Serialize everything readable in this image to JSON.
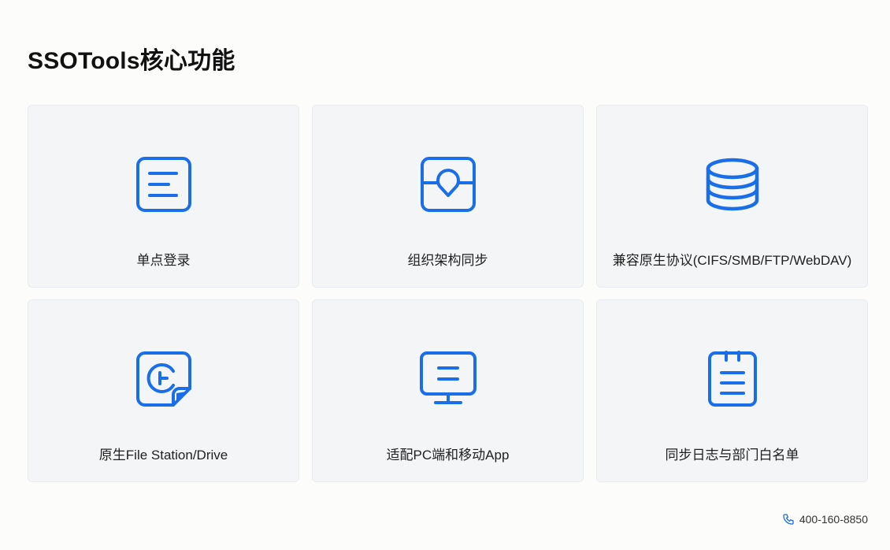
{
  "page": {
    "title": "SSOTools核心功能"
  },
  "features": [
    {
      "label": "单点登录",
      "icon": "document-lines-icon"
    },
    {
      "label": "组织架构同步",
      "icon": "location-pin-icon"
    },
    {
      "label": "兼容原生协议(CIFS/SMB/FTP/WebDAV)",
      "icon": "database-icon"
    },
    {
      "label": "原生File Station/Drive",
      "icon": "file-station-icon"
    },
    {
      "label": "适配PC端和移动App",
      "icon": "monitor-icon"
    },
    {
      "label": "同步日志与部门白名单",
      "icon": "clipboard-list-icon"
    }
  ],
  "contact": {
    "phone": "400-160-8850",
    "icon": "phone-icon"
  },
  "colors": {
    "accent": "#1a6ee8",
    "card_bg": "#f3f5f7",
    "page_bg": "#fcfcfb"
  }
}
